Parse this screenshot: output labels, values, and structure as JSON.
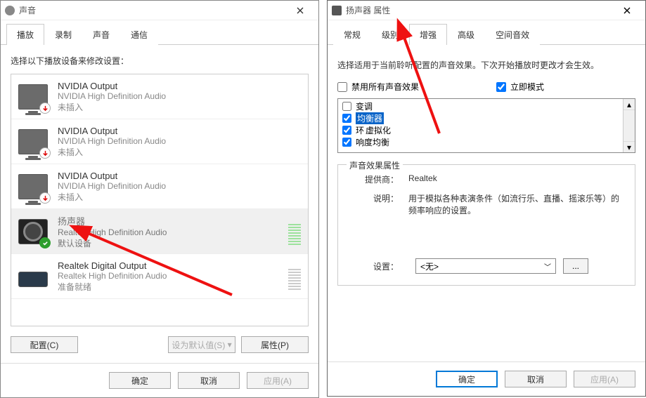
{
  "left": {
    "title": "声音",
    "tabs": [
      "播放",
      "录制",
      "声音",
      "通信"
    ],
    "activeTab": 0,
    "instruction": "选择以下播放设备来修改设置：",
    "devices": [
      {
        "title": "NVIDIA Output",
        "sub": "NVIDIA High Definition Audio",
        "status": "未插入"
      },
      {
        "title": "NVIDIA Output",
        "sub": "NVIDIA High Definition Audio",
        "status": "未插入"
      },
      {
        "title": "NVIDIA Output",
        "sub": "NVIDIA High Definition Audio",
        "status": "未插入"
      },
      {
        "title": "扬声器",
        "sub": "Realtek High Definition Audio",
        "status": "默认设备"
      },
      {
        "title": "Realtek Digital Output",
        "sub": "Realtek High Definition Audio",
        "status": "准备就绪"
      }
    ],
    "buttons": {
      "configure": "配置(C)",
      "setDefault": "设为默认值(S)",
      "properties": "属性(P)"
    },
    "footer": {
      "ok": "确定",
      "cancel": "取消",
      "apply": "应用(A)"
    }
  },
  "right": {
    "title": "扬声器 属性",
    "tabs": [
      "常规",
      "级别",
      "增强",
      "高级",
      "空间音效"
    ],
    "activeTab": 2,
    "description": "选择适用于当前聆听配置的声音效果。下次开始播放时更改才会生效。",
    "disableAll": {
      "label": "禁用所有声音效果",
      "checked": false
    },
    "immediate": {
      "label": "立即模式",
      "checked": true
    },
    "effects": [
      {
        "label": "变调",
        "checked": false
      },
      {
        "label": "均衡器",
        "checked": true,
        "highlight": true
      },
      {
        "label": "虚拟化",
        "checked": true,
        "prefix": "环"
      },
      {
        "label": "响度均衡",
        "checked": true
      }
    ],
    "fieldsetTitle": "声音效果属性",
    "provider": {
      "label": "提供商：",
      "value": "Realtek"
    },
    "descLabel": "说明：",
    "descValue": "用于模拟各种表演条件（如流行乐、直播、摇滚乐等）的频率响应的设置。",
    "settings": {
      "label": "设置：",
      "value": "<无>",
      "ellipsis": "..."
    },
    "footer": {
      "ok": "确定",
      "cancel": "取消",
      "apply": "应用(A)"
    }
  }
}
